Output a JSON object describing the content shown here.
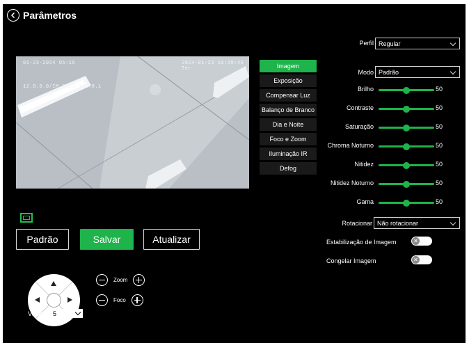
{
  "header": {
    "title": "Parâmetros",
    "back_icon": "circle-chevron-left-icon"
  },
  "video": {
    "osd_top_left": "01-23-2024 05:16",
    "osd_top_right": "2024-01-23 10:39:49 Ter",
    "osd_second_line": "12.0.0.0/IM 5121/178.8.1"
  },
  "buttons": {
    "default": "Padrão",
    "save": "Salvar",
    "refresh": "Atualizar"
  },
  "tabs": [
    {
      "label": "Imagem",
      "active": true
    },
    {
      "label": "Exposição",
      "active": false
    },
    {
      "label": "Compensar Luz",
      "active": false
    },
    {
      "label": "Balanço de Branco",
      "active": false
    },
    {
      "label": "Dia e Noite",
      "active": false
    },
    {
      "label": "Foco e Zoom",
      "active": false
    },
    {
      "label": "Iluminação IR",
      "active": false
    },
    {
      "label": "Defog",
      "active": false
    }
  ],
  "settings": {
    "profile": {
      "label": "Perfil",
      "value": "Regular"
    },
    "mode": {
      "label": "Modo",
      "value": "Padrão"
    },
    "sliders": [
      {
        "label": "Brilho",
        "value": "50",
        "level": 0.5
      },
      {
        "label": "Contraste",
        "value": "50",
        "level": 0.5
      },
      {
        "label": "Saturação",
        "value": "50",
        "level": 0.5
      },
      {
        "label": "Chroma Noturno",
        "value": "50",
        "level": 0.5
      },
      {
        "label": "Nitidez",
        "value": "50",
        "level": 0.5
      },
      {
        "label": "Nitidez Noturno",
        "value": "50",
        "level": 0.5
      },
      {
        "label": "Gama",
        "value": "50",
        "level": 0.5
      }
    ],
    "rotate": {
      "label": "Rotacionar",
      "value": "Não rotacionar"
    },
    "stabilization": {
      "label": "Estabilização de Imagem",
      "enabled": false
    },
    "freeze": {
      "label": "Congelar Imagem",
      "enabled": false
    }
  },
  "ptz": {
    "zoom_label": "Zoom",
    "focus_label": "Foco",
    "speed_label": "Veloci...",
    "speed_value": "5"
  },
  "colors": {
    "accent": "#1fb34b",
    "background": "#000000"
  }
}
